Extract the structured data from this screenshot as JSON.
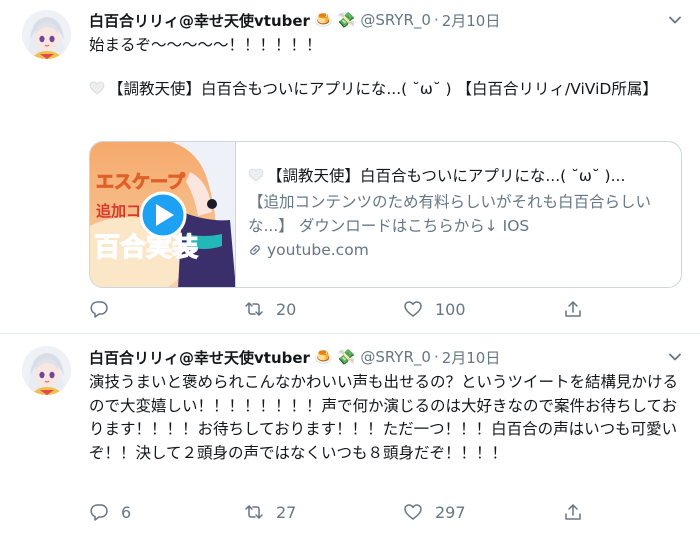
{
  "tweets": [
    {
      "author_name": "白百合リリィ@幸せ天使vtuber",
      "emoji": [
        "🍮",
        "💸"
      ],
      "handle": "@SRYR_0",
      "separator": "·",
      "date": "2月10日",
      "text_line1": "始まるぞ〜〜〜〜〜！！！！！！",
      "text_line2": "【調教天使】白百合もついにアプリにな...( ˘ω˘ ) 【白百合リリィ/ViViD所属】",
      "card": {
        "title": "【調教天使】白百合もついにアプリにな...( ˘ω˘ )...",
        "description": "【追加コンテンツのため有料らしいがそれも白百合らしいな...】 ダウンロードはこちらから↓ IOS",
        "domain": "youtube.com",
        "thumb_text_top": "エスケープ",
        "thumb_text_mid": "追加コン",
        "thumb_text_bottom": "百合実装"
      },
      "replies": "",
      "retweets": "20",
      "likes": "100"
    },
    {
      "author_name": "白百合リリィ@幸せ天使vtuber",
      "emoji": [
        "🍮",
        "💸"
      ],
      "handle": "@SRYR_0",
      "separator": "·",
      "date": "2月10日",
      "text": "演技うまいと褒められこんなかわいい声も出せるの？というツイートを結構見かけるので大変嬉しい！！！！！！！！声で何か演じるのは大好きなので案件お待ちしております！！！！お待ちしております！！！ただ一つ！！！白百合の声はいつも可愛いぞ！！決して２頭身の声ではなくいつも８頭身だぞ！！！！",
      "replies": "6",
      "retweets": "27",
      "likes": "297"
    }
  ],
  "colors": {
    "text": "#14171a",
    "secondary": "#657786",
    "border": "#e6ecf0",
    "card_border": "#ccd6dd",
    "play_button": "#1da1f2"
  },
  "icons": {
    "reply": "reply-icon",
    "retweet": "retweet-icon",
    "like": "heart-icon",
    "share": "share-icon",
    "more": "chevron-down-icon",
    "link": "link-icon",
    "play": "play-icon"
  }
}
